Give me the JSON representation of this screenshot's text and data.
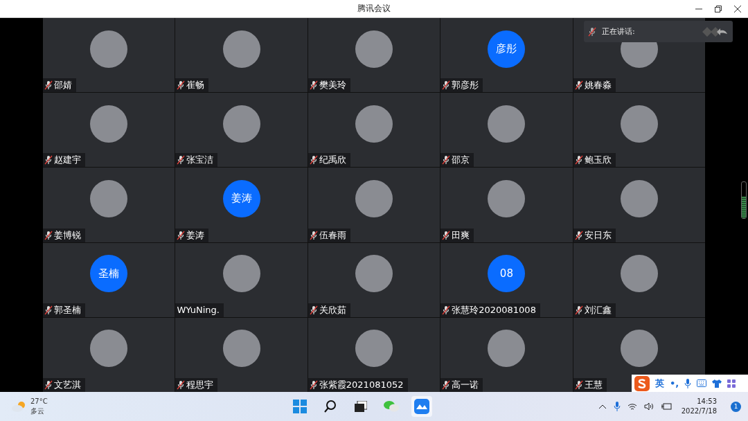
{
  "window": {
    "title": "腾讯会议"
  },
  "tiles": [
    {
      "name": "邵婧",
      "muted": true,
      "avatar": {
        "kind": "photo"
      }
    },
    {
      "name": "崔畅",
      "muted": true,
      "avatar": {
        "kind": "photo"
      }
    },
    {
      "name": "樊美玲",
      "muted": true,
      "avatar": {
        "kind": "photo"
      }
    },
    {
      "name": "郭彦彤",
      "muted": true,
      "avatar": {
        "kind": "initials",
        "text": "彦彤"
      }
    },
    {
      "name": "姚春淼",
      "muted": true,
      "avatar": {
        "kind": "photo"
      }
    },
    {
      "name": "赵建宇",
      "muted": true,
      "avatar": {
        "kind": "photo"
      }
    },
    {
      "name": "张宝洁",
      "muted": true,
      "avatar": {
        "kind": "photo"
      }
    },
    {
      "name": "纪禹欣",
      "muted": true,
      "avatar": {
        "kind": "photo"
      }
    },
    {
      "name": "邵京",
      "muted": true,
      "avatar": {
        "kind": "photo"
      }
    },
    {
      "name": "鲍玉欣",
      "muted": true,
      "avatar": {
        "kind": "photo"
      }
    },
    {
      "name": "姜博锐",
      "muted": true,
      "avatar": {
        "kind": "photo"
      }
    },
    {
      "name": "姜涛",
      "muted": true,
      "avatar": {
        "kind": "initials",
        "text": "姜涛"
      }
    },
    {
      "name": "伍春雨",
      "muted": true,
      "avatar": {
        "kind": "photo"
      }
    },
    {
      "name": "田爽",
      "muted": true,
      "avatar": {
        "kind": "photo"
      }
    },
    {
      "name": "安日东",
      "muted": true,
      "avatar": {
        "kind": "photo"
      }
    },
    {
      "name": "郭圣楠",
      "muted": true,
      "avatar": {
        "kind": "initials",
        "text": "圣楠"
      }
    },
    {
      "name": "WYuNing.",
      "muted": false,
      "avatar": {
        "kind": "photo"
      }
    },
    {
      "name": "关欣茹",
      "muted": true,
      "avatar": {
        "kind": "photo"
      }
    },
    {
      "name": "张慧玲2020081008",
      "muted": true,
      "avatar": {
        "kind": "initials",
        "text": "08"
      }
    },
    {
      "name": "刘汇鑫",
      "muted": true,
      "avatar": {
        "kind": "photo"
      }
    },
    {
      "name": "文艺淇",
      "muted": true,
      "avatar": {
        "kind": "photo"
      }
    },
    {
      "name": "程思宇",
      "muted": true,
      "avatar": {
        "kind": "photo"
      }
    },
    {
      "name": "张紫霞2021081052",
      "muted": true,
      "avatar": {
        "kind": "photo"
      }
    },
    {
      "name": "高一诺",
      "muted": true,
      "avatar": {
        "kind": "photo"
      }
    },
    {
      "name": "王慧",
      "muted": true,
      "avatar": {
        "kind": "photo"
      }
    }
  ],
  "speaking_panel": {
    "label": "正在讲话:"
  },
  "volume_meter": {
    "level": 0.6
  },
  "ime_toolbar": {
    "language": "英",
    "punctuation": "•,"
  },
  "taskbar": {
    "weather": {
      "temperature": "27°C",
      "condition": "多云"
    },
    "clock": {
      "time": "14:53",
      "date": "2022/7/18"
    },
    "notification_count": "1"
  }
}
